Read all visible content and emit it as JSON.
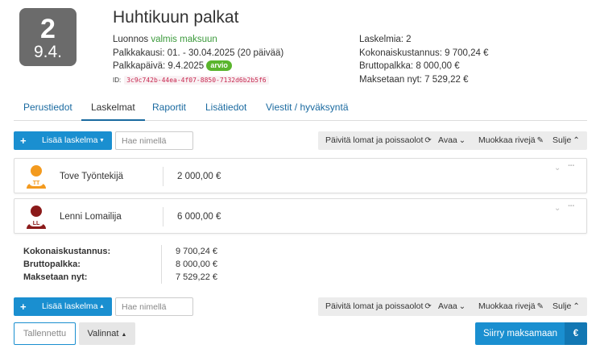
{
  "header": {
    "badge_day": "2",
    "badge_month": "9.4.",
    "title": "Huhtikuun palkat",
    "status_prefix": "Luonnos",
    "status_value": "valmis maksuun",
    "period_label": "Palkkakausi:",
    "period_value": "01. - 30.04.2025 (20 päivää)",
    "payday_label": "Palkkapäivä:",
    "payday_value": "9.4.2025",
    "estimate_badge": "arvio",
    "id_label": "ID:",
    "id_value": "3c9c742b-44ea-4f07-8850-7132d6b2b5f6",
    "calculations": "Laskelmia: 2",
    "total_cost": "Kokonaiskustannus: 9 700,24 €",
    "gross_pay": "Bruttopalkka: 8 000,00 €",
    "payable_now": "Maksetaan nyt: 7 529,22 €"
  },
  "tabs": [
    {
      "label": "Perustiedot"
    },
    {
      "label": "Laskelmat"
    },
    {
      "label": "Raportit"
    },
    {
      "label": "Lisätiedot"
    },
    {
      "label": "Viestit / hyväksyntä"
    }
  ],
  "toolbar": {
    "add_label": "Lisää laskelma",
    "search_placeholder": "Hae nimellä",
    "update_label": "Päivitä lomat ja poissaolot",
    "open_label": "Avaa",
    "edit_rows_label": "Muokkaa rivejä",
    "close_label": "Sulje"
  },
  "rows": [
    {
      "name": "Tove Työntekijä",
      "amount": "2 000,00 €",
      "initials": "TT",
      "avatar_color": "#f39a1e"
    },
    {
      "name": "Lenni Lomailija",
      "amount": "6 000,00 €",
      "initials": "LL",
      "avatar_color": "#8b1a1a"
    }
  ],
  "totals": {
    "total_cost_label": "Kokonaiskustannus:",
    "total_cost_value": "9 700,24 €",
    "gross_label": "Bruttopalkka:",
    "gross_value": "8 000,00 €",
    "payable_label": "Maksetaan nyt:",
    "payable_value": "7 529,22 €"
  },
  "footer": {
    "saved_label": "Tallennettu",
    "options_label": "Valinnat",
    "pay_label": "Siirry maksamaan",
    "pay_icon": "€"
  },
  "colors": {
    "primary": "#1a8fd0",
    "badge_bg": "#6b6b6b",
    "estimate_green": "#5ab52d"
  }
}
